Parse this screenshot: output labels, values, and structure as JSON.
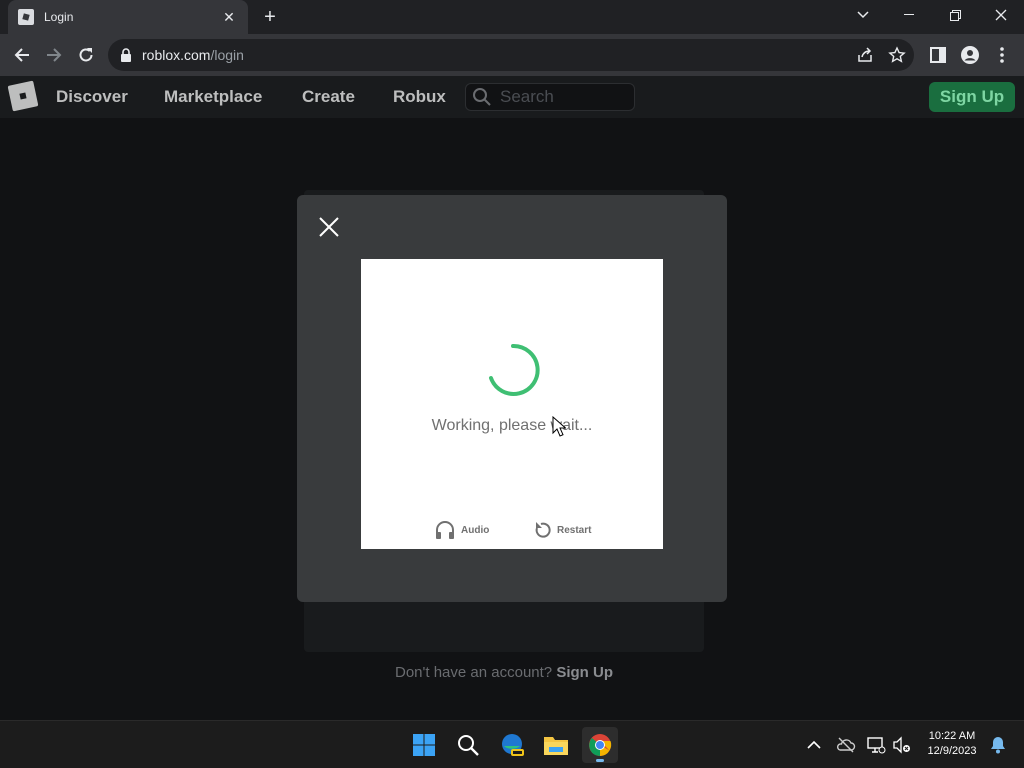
{
  "browser": {
    "tab_title": "Login",
    "url_host": "roblox.com",
    "url_path": "/login"
  },
  "header": {
    "nav": [
      "Discover",
      "Marketplace",
      "Create",
      "Robux"
    ],
    "search_placeholder": "Search",
    "signup_label": "Sign Up"
  },
  "background": {
    "prompt": "Don't have an account?",
    "link": "Sign Up"
  },
  "captcha": {
    "status": "Working, please wait...",
    "audio_label": "Audio",
    "restart_label": "Restart"
  },
  "taskbar": {
    "time": "10:22 AM",
    "date": "12/9/2023"
  },
  "colors": {
    "spinner": "#3fbf73",
    "signup_bg": "#1a6e3f",
    "signup_text": "#7ed6a3",
    "modal_bg": "#393b3d"
  }
}
